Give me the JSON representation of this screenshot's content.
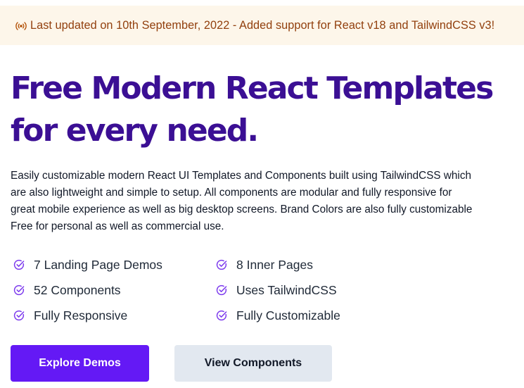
{
  "banner": {
    "icon": "broadcast-icon",
    "text": "Last updated on 10th September, 2022 - Added support for React v18 and TailwindCSS v3!"
  },
  "hero": {
    "headline_line1": "Free Modern React Templates",
    "headline_line2": "for every need.",
    "description_lines": [
      "Easily customizable modern React UI Templates and Components built using TailwindCSS which",
      "are also lightweight and simple to setup. All components are modular and fully responsive for",
      "great mobile experience as well as big desktop screens. Brand Colors are also fully customizable",
      "Free for personal as well as commercial use."
    ]
  },
  "features": [
    {
      "label": "7 Landing Page Demos",
      "icon": "check-circle-icon"
    },
    {
      "label": "8 Inner Pages",
      "icon": "check-circle-icon"
    },
    {
      "label": "52 Components",
      "icon": "check-circle-icon"
    },
    {
      "label": "Uses TailwindCSS",
      "icon": "check-circle-icon"
    },
    {
      "label": "Fully Responsive",
      "icon": "check-circle-icon"
    },
    {
      "label": "Fully Customizable",
      "icon": "check-circle-icon"
    }
  ],
  "buttons": {
    "primary": "Explore Demos",
    "secondary": "View Components"
  },
  "colors": {
    "banner_bg": "#fdf6ea",
    "banner_text": "#92400e",
    "headline": "#3b0f94",
    "accent": "#6419f5",
    "secondary_button_bg": "#e2e8f0"
  }
}
